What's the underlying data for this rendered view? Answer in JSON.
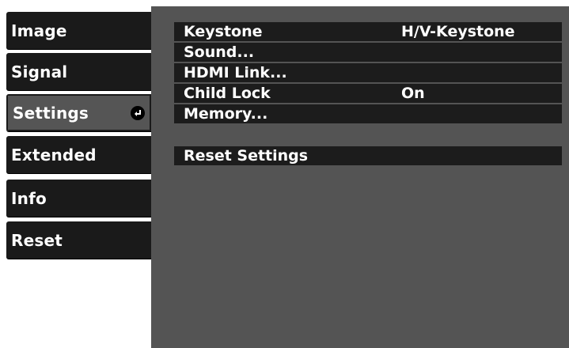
{
  "sidebar": {
    "tabs": [
      {
        "label": "Image"
      },
      {
        "label": "Signal"
      },
      {
        "label": "Settings",
        "selected": true
      },
      {
        "label": "Extended"
      },
      {
        "label": "Info"
      },
      {
        "label": "Reset"
      }
    ],
    "selected_icon": "enter-icon"
  },
  "settings": {
    "items": [
      {
        "label": "Keystone",
        "value": "H/V-Keystone"
      },
      {
        "label": "Sound..."
      },
      {
        "label": "HDMI Link..."
      },
      {
        "label": "Child Lock",
        "value": "On"
      },
      {
        "label": "Memory..."
      }
    ],
    "reset_label": "Reset Settings"
  },
  "colors": {
    "tab_background": "#1a1a1a",
    "selected_tab_background": "#555555",
    "panel_background": "#545454",
    "row_background": "#1c1c1c",
    "text": "#ffffff"
  }
}
